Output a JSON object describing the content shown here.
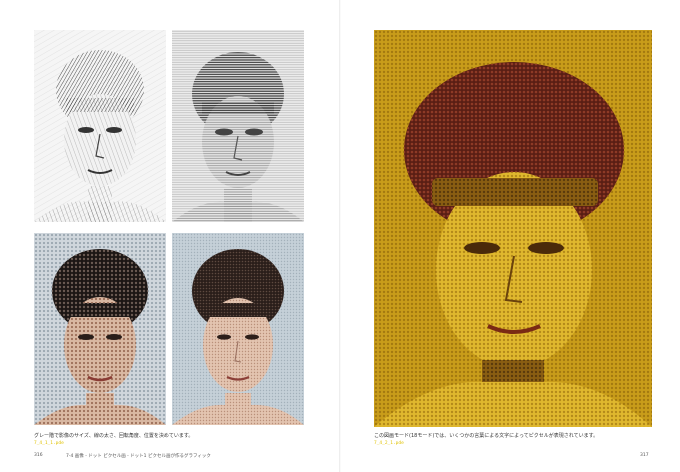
{
  "book": {
    "left_page": {
      "page_number": "316",
      "running_head": "7-4 画像 - ドット ピクセル画 - ドット1 ピクセル画が作るグラフィック",
      "caption": "グレー階で影像のサイズ、線の太さ、回転角度、位置を決めています。",
      "code_ref": "7_4_1_1.pde",
      "figures": [
        {
          "name": "line-portrait-sketch",
          "style": "grayscale lines"
        },
        {
          "name": "line-portrait-embossed",
          "style": "grayscale relief lines"
        },
        {
          "name": "pixel-portrait-coarse",
          "style": "color pixels"
        },
        {
          "name": "pixel-portrait-fine",
          "style": "color pixels"
        }
      ]
    },
    "right_page": {
      "page_number": "317",
      "caption": "この図画モード(18モード)では、いくつかの言葉による文字によってピクセルが表現されています。",
      "code_ref": "7_4_2_1.pde",
      "figure": {
        "name": "text-pixel-portrait",
        "style": "warm yellow and brown dots"
      }
    },
    "colors": {
      "code_accent": "#e0c200",
      "big_background": "#c99d1a",
      "hair_dark": "#5a1e14"
    }
  }
}
